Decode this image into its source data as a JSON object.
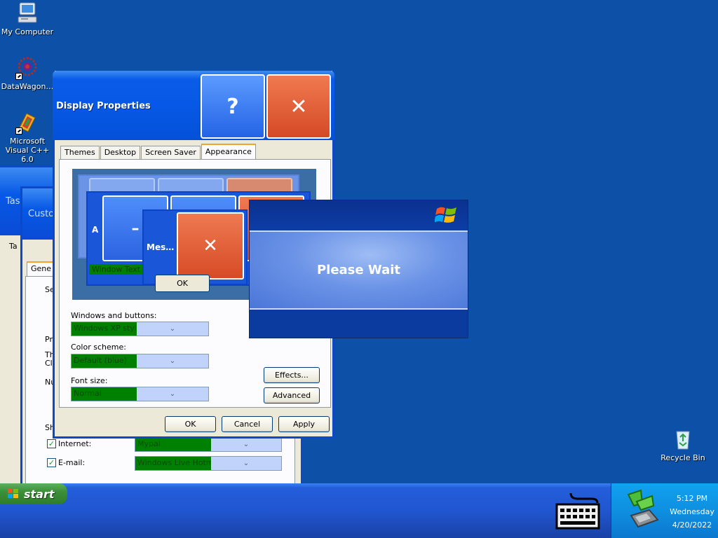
{
  "desktop": {
    "icons": [
      {
        "label": "My Computer",
        "icon": "my-computer-icon"
      },
      {
        "label": "DataWagon…",
        "icon": "datawagon-icon"
      },
      {
        "label": "Microsoft Visual C++ 6.0",
        "icon": "visual-cpp-icon"
      },
      {
        "label": "Recycle Bin",
        "icon": "recycle-bin-icon"
      }
    ]
  },
  "background_windows": {
    "task_title": "Task",
    "custom_title": "Custom",
    "tab_fragment": "Ta",
    "general_tab": "Gene",
    "frag_se": "Se",
    "frag_pr": "Pr",
    "frag_th": "Th",
    "frag_cl": "Cl",
    "frag_nu": "Nu",
    "frag_sh": "Sh",
    "internet_label": "Internet:",
    "internet_value": "Mypal",
    "email_label": "E-mail:",
    "email_value": "Windows Live Hotmai"
  },
  "dialog": {
    "title": "Display Properties",
    "help_glyph": "?",
    "close_glyph": "✕",
    "tabs": [
      "Themes",
      "Desktop",
      "Screen Saver",
      "Appearance"
    ],
    "active_tab": "Appearance",
    "preview": {
      "inactive_title": "A",
      "message_title": "Mes…",
      "window_text": "Window Text",
      "ok_label": "OK"
    },
    "windows_buttons_label": "Windows and buttons:",
    "windows_buttons_value": "Windows XP style",
    "color_scheme_label": "Color scheme:",
    "color_scheme_value": "Default (blue)",
    "font_size_label": "Font size:",
    "font_size_value": "Normal",
    "effects_label": "Effects...",
    "advanced_label": "Advanced",
    "ok_label": "OK",
    "cancel_label": "Cancel",
    "apply_label": "Apply"
  },
  "splash": {
    "text": "Please Wait",
    "logo": "windows-flag-icon"
  },
  "taskbar": {
    "start_label": "start",
    "time": "5:12 PM",
    "day": "Wednesday",
    "date": "4/20/2022"
  },
  "colors": {
    "desktop": "#0d50a8",
    "titlebar": "#0758e6",
    "dialog_face": "#ece9d8",
    "combo_selected": "#008000",
    "close_red": "#d44a26",
    "start_green": "#3c8f38"
  }
}
